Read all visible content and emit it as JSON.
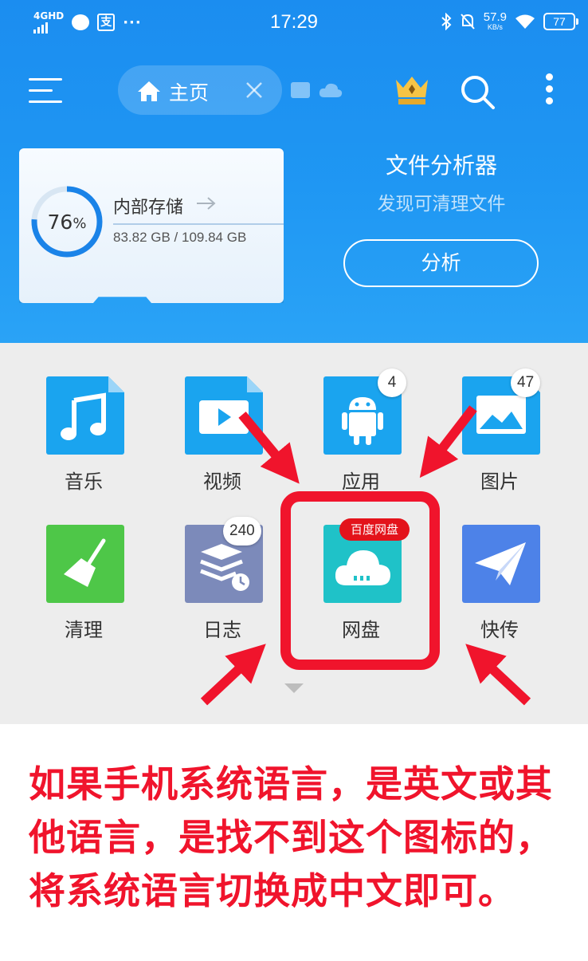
{
  "status_bar": {
    "network": "4GHD",
    "app_icon_text": "支",
    "more": "···",
    "time": "17:29",
    "speed_value": "57.9",
    "speed_unit": "KB/s",
    "battery": "77"
  },
  "toolbar": {
    "home_tab_label": "主页"
  },
  "storage": {
    "percent": "76",
    "percent_symbol": "%",
    "title": "内部存储",
    "usage": "83.82 GB / 109.84 GB",
    "used_fraction": 0.76
  },
  "analyzer": {
    "title": "文件分析器",
    "subtitle": "发现可清理文件",
    "button": "分析"
  },
  "apps": [
    {
      "label": "音乐",
      "icon": "music-icon",
      "color": "#1aa4ef"
    },
    {
      "label": "视频",
      "icon": "video-icon",
      "color": "#1aa4ef"
    },
    {
      "label": "应用",
      "icon": "android-icon",
      "color": "#1aa4ef",
      "badge": "4"
    },
    {
      "label": "图片",
      "icon": "image-icon",
      "color": "#1aa4ef",
      "badge": "47"
    },
    {
      "label": "清理",
      "icon": "broom-icon",
      "color": "#4ec748"
    },
    {
      "label": "日志",
      "icon": "log-icon",
      "color": "#7c8aba",
      "badge": "240"
    },
    {
      "label": "网盘",
      "icon": "cloud-icon",
      "color": "#1fc2c8",
      "tag": "百度网盘"
    },
    {
      "label": "快传",
      "icon": "paper-plane-icon",
      "color": "#4d82e8"
    }
  ],
  "caption": "如果手机系统语言，是英文或其他语言，是找不到这个图标的，将系统语言切换成中文即可。",
  "colors": {
    "header": "#1f97f3",
    "highlight": "#f0142c",
    "caption": "#f0142c"
  }
}
